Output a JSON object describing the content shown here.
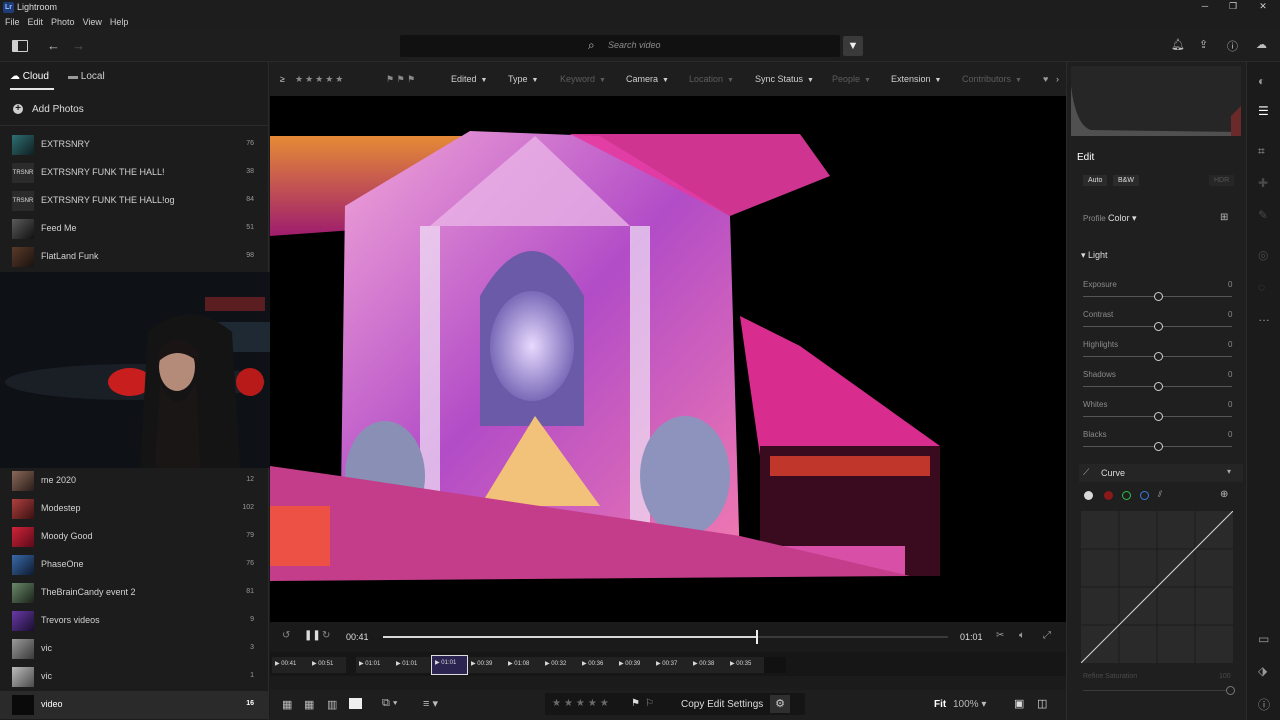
{
  "window": {
    "title": "Lightroom",
    "logo": "Lr"
  },
  "menu": [
    "File",
    "Edit",
    "Photo",
    "View",
    "Help"
  ],
  "search": {
    "placeholder": "Search video"
  },
  "panel_tabs": {
    "cloud": "Cloud",
    "local": "Local"
  },
  "add_photos": "Add Photos",
  "albums_top": [
    {
      "name": "EXTRSNRY",
      "count": "76"
    },
    {
      "name": "EXTRSNRY FUNK THE HALL!",
      "count": "38"
    },
    {
      "name": "EXTRSNRY FUNK THE HALL!og",
      "count": "84"
    },
    {
      "name": "Feed Me",
      "count": "51"
    },
    {
      "name": "FlatLand Funk",
      "count": "98"
    }
  ],
  "albums_bottom": [
    {
      "name": "me 2020",
      "count": "12"
    },
    {
      "name": "Modestep",
      "count": "102"
    },
    {
      "name": "Moody Good",
      "count": "79"
    },
    {
      "name": "PhaseOne",
      "count": "76"
    },
    {
      "name": "TheBrainCandy event 2",
      "count": "81"
    },
    {
      "name": "Trevors videos",
      "count": "9"
    },
    {
      "name": "vic",
      "count": "3"
    },
    {
      "name": "vic",
      "count": "1"
    },
    {
      "name": "video",
      "count": "16"
    }
  ],
  "filters": {
    "rating_op": "≥",
    "edited": "Edited",
    "type": "Type",
    "keyword": "Keyword",
    "camera": "Camera",
    "location": "Location",
    "sync": "Sync Status",
    "people": "People",
    "extension": "Extension",
    "contributors": "Contributors"
  },
  "video": {
    "current_time": "00:41",
    "end_time": "01:01",
    "progress": 0.66,
    "frames": [
      "00:41",
      "00:51",
      "01:01",
      "01:01",
      "01:01",
      "00:39",
      "01:08",
      "00:32",
      "00:36",
      "00:39",
      "00:37",
      "00:38",
      "00:35"
    ]
  },
  "bottom": {
    "copy_edit": "Copy Edit Settings",
    "fit": "Fit",
    "zoom": "100%"
  },
  "edit": {
    "title": "Edit",
    "auto": "Auto",
    "bw": "B&W",
    "hdr": "HDR",
    "profile_label": "Profile",
    "profile_value": "Color",
    "light_section": "Light",
    "sliders": [
      {
        "label": "Exposure",
        "value": "0"
      },
      {
        "label": "Contrast",
        "value": "0"
      },
      {
        "label": "Highlights",
        "value": "0"
      },
      {
        "label": "Shadows",
        "value": "0"
      },
      {
        "label": "Whites",
        "value": "0"
      },
      {
        "label": "Blacks",
        "value": "0"
      }
    ],
    "curve_section": "Curve",
    "refine_saturation": "Refine Saturation",
    "refine_value": "100"
  }
}
